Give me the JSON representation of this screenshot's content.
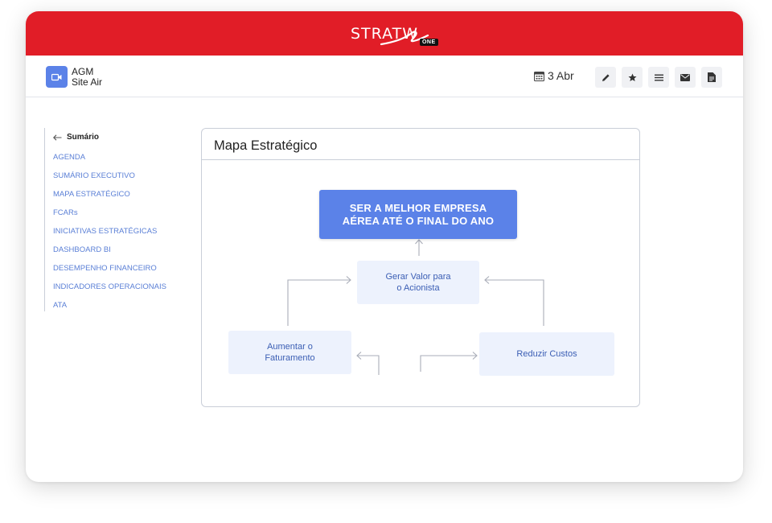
{
  "brand": {
    "name": "STRATW",
    "badge": "ONE"
  },
  "header": {
    "meeting_title_line1": "AGM",
    "meeting_title_line2": "Site Air",
    "date": "3 Abr"
  },
  "toolbar": {
    "icons": [
      "pencil-icon",
      "star-icon",
      "menu-icon",
      "mail-icon",
      "document-icon"
    ]
  },
  "sidebar": {
    "back_label": "Sumário",
    "items": [
      {
        "label": "AGENDA"
      },
      {
        "label": "SUMÁRIO EXECUTIVO"
      },
      {
        "label": "MAPA ESTRATÉGICO"
      },
      {
        "label": "FCARs"
      },
      {
        "label": "INICIATIVAS ESTRATÉGICAS"
      },
      {
        "label": "DASHBOARD BI"
      },
      {
        "label": "DESEMPENHO FINANCEIRO"
      },
      {
        "label": "INDICADORES OPERACIONAIS"
      },
      {
        "label": "ATA"
      }
    ]
  },
  "main": {
    "panel_title": "Mapa Estratégico",
    "goal_line1": "SER A MELHOR EMPRESA",
    "goal_line2": "AÉREA ATÉ O FINAL DO ANO",
    "value_line1": "Gerar Valor para",
    "value_line2": "o Acionista",
    "revenue_line1": "Aumentar o",
    "revenue_line2": "Faturamento",
    "costs": "Reduzir Custos"
  },
  "colors": {
    "brand_red": "#e11d27",
    "accent_blue": "#5b82e8",
    "light_box": "#edf2fd",
    "nav_link": "#5a7fd6"
  }
}
